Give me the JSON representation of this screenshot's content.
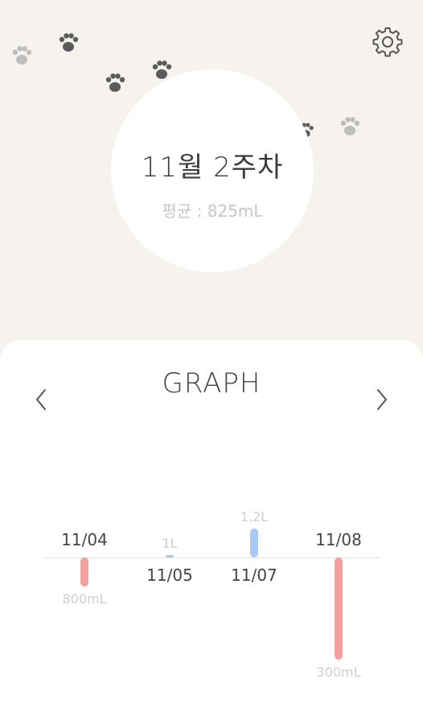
{
  "header": {
    "settings_icon": "gear-icon",
    "decorations": [
      "paw-icon",
      "paw-icon",
      "paw-icon",
      "paw-icon",
      "paw-icon",
      "paw-icon"
    ]
  },
  "summary": {
    "week_title": "11월 2주차",
    "average": "평균 : 825mL"
  },
  "graph": {
    "title": "GRAPH",
    "prev_icon": "chevron-left-icon",
    "next_icon": "chevron-right-icon"
  },
  "colors": {
    "background": "#f6f2ed",
    "card": "#ffffff",
    "below_target": "#f4a0a0",
    "above_target": "#a9c8f5",
    "paw_dark": "#5b5b5b",
    "paw_light": "#bdbdbd"
  },
  "chart_data": {
    "type": "bar",
    "categories": [
      "11/04",
      "11/05",
      "11/07",
      "11/08"
    ],
    "values": [
      800,
      1000,
      1200,
      300
    ],
    "value_labels": [
      "800mL",
      "1L",
      "1.2L",
      "300mL"
    ],
    "baseline": 1000,
    "xlabel": "",
    "ylabel": "",
    "ylim": [
      300,
      1200
    ]
  }
}
